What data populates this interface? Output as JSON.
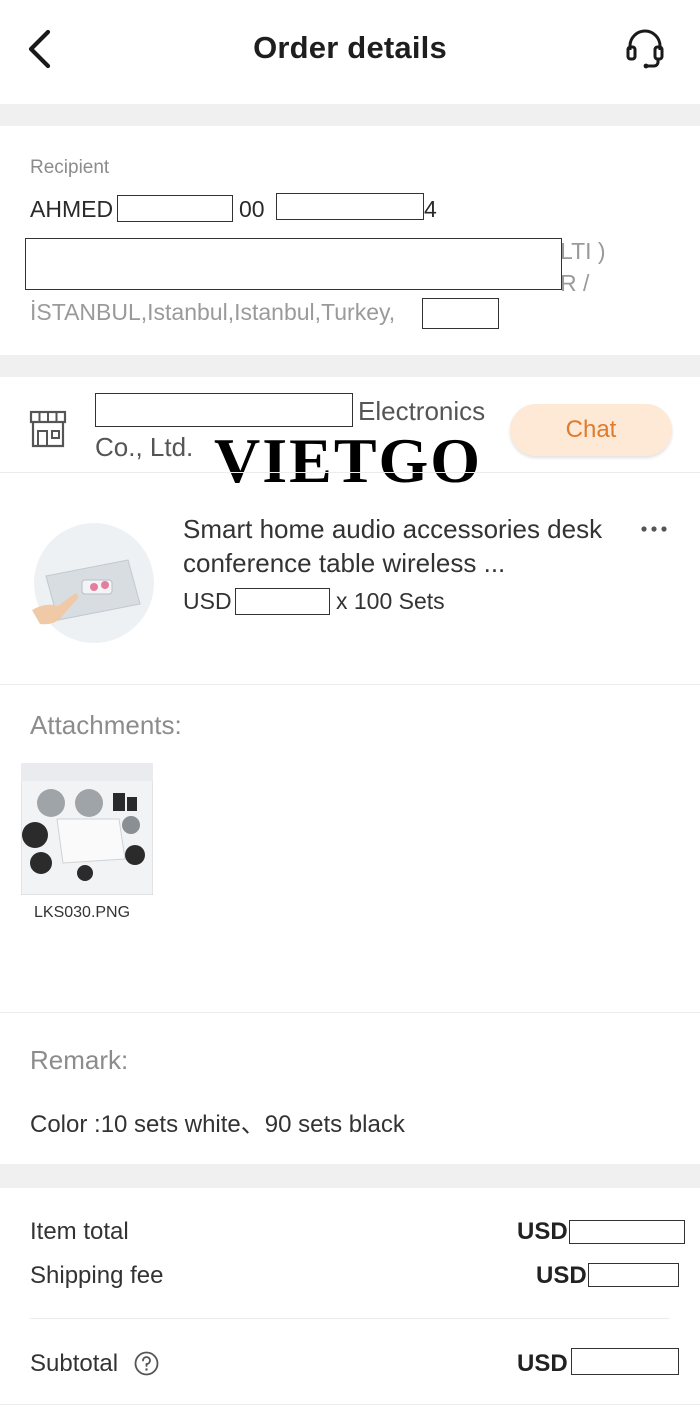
{
  "header": {
    "title": "Order details",
    "back_icon": "chevron-left-icon",
    "support_icon": "headset-icon"
  },
  "recipient": {
    "label": "Recipient",
    "name": "AHMED",
    "phone_prefix": "00",
    "phone_suffix": "4",
    "address_partial_1": "LTI )",
    "address_partial_2": "R /",
    "address_city": "İSTANBUL,Istanbul,Istanbul,Turkey,"
  },
  "supplier": {
    "name_visible": "Electronics",
    "name_suffix": "Co., Ltd.",
    "chat_label": "Chat",
    "store_icon": "store-icon"
  },
  "watermark": "VIETGO",
  "product": {
    "title": "Smart home audio accessories desk conference table wireless ...",
    "currency": "USD",
    "quantity": "x 100 Sets",
    "more_icon": "more-horizontal-icon"
  },
  "attachments": {
    "label": "Attachments:",
    "files": [
      {
        "name": "LKS030.PNG"
      }
    ]
  },
  "remark": {
    "label": "Remark:",
    "text": "Color :10 sets  white、90 sets  black"
  },
  "totals": {
    "item_total_label": "Item total",
    "item_total_currency": "USD",
    "shipping_fee_label": "Shipping fee",
    "shipping_fee_currency": "USD",
    "subtotal_label": "Subtotal",
    "subtotal_currency": "USD",
    "help_icon": "help-circle-icon"
  },
  "colors": {
    "chat_bg": "#fde9d6",
    "chat_text": "#e07a2c",
    "section_divider": "#f0f0f0"
  }
}
